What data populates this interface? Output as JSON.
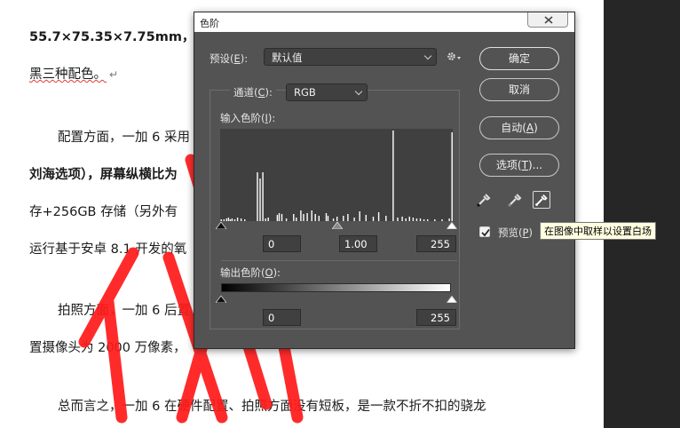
{
  "document": {
    "lines": [
      "55.7×75.35×7.75mm，",
      "黑三种配色。",
      "配置方面，一加 6 采用",
      "刘海选项），屏幕纵横比为",
      "存+256GB 存储（另外有",
      "运行基于安卓 8.1 开发的氧",
      "拍照方面，一加 6 后置",
      "置摄像头为 2000 万像素，",
      "总而言之，一加 6 在硬件配置、拍照方面没有短板，是一款不折不扣的骁龙",
      "↵"
    ],
    "watermark_color": "#ff1a1a"
  },
  "dialog": {
    "title": "色阶",
    "preset": {
      "label": "预设(",
      "key": "E",
      "suffix": "):",
      "value": "默认值"
    },
    "channel": {
      "label": "通道(",
      "key": "C",
      "suffix": "):",
      "value": "RGB"
    },
    "input_levels_label": {
      "prefix": "输入色阶(",
      "key": "I",
      "suffix": "):"
    },
    "output_levels_label": {
      "prefix": "输出色阶(",
      "key": "O",
      "suffix": "):"
    },
    "input_values": {
      "black": "0",
      "gamma": "1.00",
      "white": "255"
    },
    "output_values": {
      "black": "0",
      "white": "255"
    },
    "buttons": {
      "ok": "确定",
      "cancel": "取消",
      "auto": {
        "prefix": "自动(",
        "key": "A",
        "suffix": ")"
      },
      "options": {
        "prefix": "选项(",
        "key": "T",
        "suffix": ")..."
      }
    },
    "preview": {
      "label_prefix": "预览(",
      "key": "P",
      "label_suffix": ")",
      "checked": true
    },
    "tooltip": "在图像中取样以设置白场",
    "icons": [
      "gear-icon",
      "black-eyedropper-icon",
      "gray-eyedropper-icon",
      "white-eyedropper-icon",
      "close-icon",
      "checkmark-icon"
    ],
    "histogram": {
      "bins": [
        [
          0,
          2
        ],
        [
          3,
          2
        ],
        [
          6,
          3
        ],
        [
          8,
          4
        ],
        [
          10,
          2
        ],
        [
          12,
          3
        ],
        [
          15,
          2
        ],
        [
          18,
          4
        ],
        [
          22,
          3
        ],
        [
          26,
          2
        ],
        [
          40,
          55
        ],
        [
          43,
          48
        ],
        [
          46,
          55
        ],
        [
          49,
          3
        ],
        [
          52,
          4
        ],
        [
          62,
          7
        ],
        [
          64,
          9
        ],
        [
          67,
          8
        ],
        [
          72,
          3
        ],
        [
          80,
          8
        ],
        [
          83,
          4
        ],
        [
          88,
          12
        ],
        [
          91,
          8
        ],
        [
          95,
          9
        ],
        [
          100,
          12
        ],
        [
          104,
          8
        ],
        [
          108,
          6
        ],
        [
          116,
          9
        ],
        [
          118,
          6
        ],
        [
          124,
          3
        ],
        [
          128,
          5
        ],
        [
          135,
          6
        ],
        [
          140,
          8
        ],
        [
          147,
          4
        ],
        [
          153,
          11
        ],
        [
          160,
          7
        ],
        [
          168,
          5
        ],
        [
          174,
          10
        ],
        [
          182,
          6
        ],
        [
          190,
          102
        ],
        [
          195,
          4
        ],
        [
          200,
          5
        ],
        [
          204,
          3
        ],
        [
          208,
          5
        ],
        [
          212,
          4
        ],
        [
          216,
          3
        ],
        [
          220,
          3
        ],
        [
          224,
          2
        ],
        [
          228,
          2
        ],
        [
          236,
          2
        ],
        [
          244,
          2
        ],
        [
          252,
          3
        ],
        [
          255,
          100
        ]
      ]
    }
  }
}
